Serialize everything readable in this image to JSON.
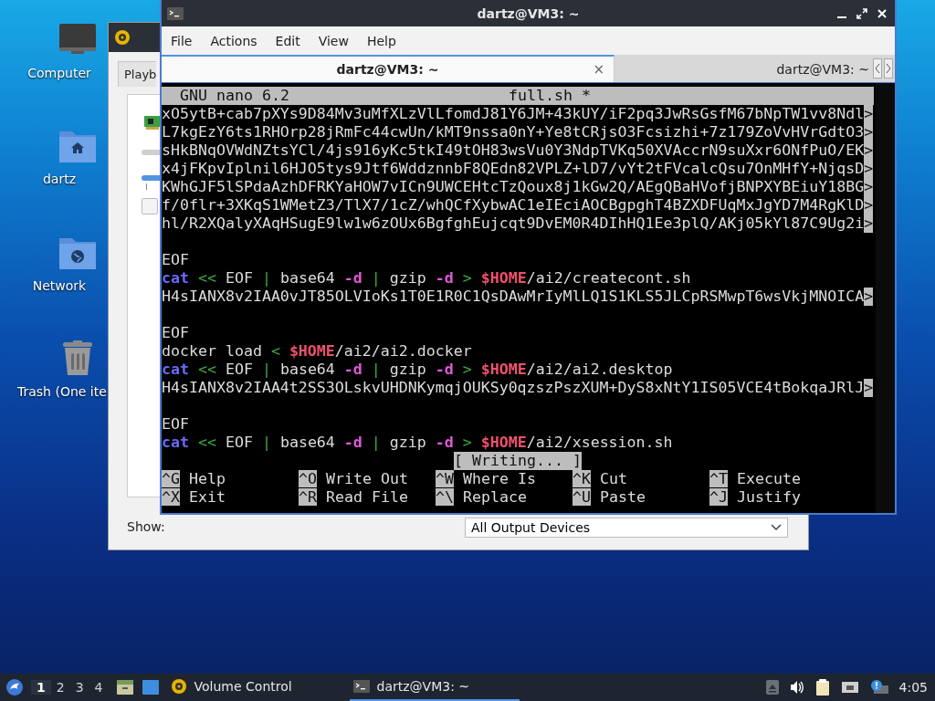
{
  "desktop_icons": [
    {
      "label": "Computer",
      "kind": "computer"
    },
    {
      "label": "dartz",
      "kind": "home"
    },
    {
      "label": "Network",
      "kind": "network"
    },
    {
      "label": "Trash (One ite",
      "kind": "trash"
    }
  ],
  "volume_window": {
    "tabs": [
      {
        "label": "Playb",
        "selected": true
      }
    ],
    "checkbox": {
      "checked": false
    },
    "show_label": "Show:",
    "device_select": "All Output Devices"
  },
  "terminal": {
    "title": "dartz@VM3: ~",
    "menu": [
      "File",
      "Actions",
      "Edit",
      "View",
      "Help"
    ],
    "tabs": [
      {
        "label": "dartz@VM3: ~",
        "selected": true,
        "close": "×"
      },
      {
        "label": "dartz@VM3: ~",
        "selected": false
      }
    ],
    "nano": {
      "version": "GNU nano 6.2",
      "filename": "full.sh *",
      "lines": [
        {
          "kind": "text",
          "segments": [
            {
              "text": "xO5ytB+cab7pXYs9D84Mv3uMfXLzVlLfomdJ81Y6JM+43kUY/iF2pq3JwRsGsfM67bNpTW1vv8Ndl",
              "kind": "plain"
            },
            {
              "text": ">",
              "kind": "more"
            }
          ]
        },
        {
          "kind": "text",
          "segments": [
            {
              "text": "L7kgEzY6ts1RHOrp28jRmFc44cwUn/kMT9nssa0nY+Ye8tCRjsO3Fcsizhi+7z179ZoVvHVrGdtO3",
              "kind": "plain"
            },
            {
              "text": ">",
              "kind": "more"
            }
          ]
        },
        {
          "kind": "text",
          "segments": [
            {
              "text": "sHkBNqOVWdNZtsYCl/4js916yKc5tkI49tOH83wsVu0Y3NdpTVKq50XVAccrN9suXxr6ONfPuO/EK",
              "kind": "plain"
            },
            {
              "text": ">",
              "kind": "more"
            }
          ]
        },
        {
          "kind": "text",
          "segments": [
            {
              "text": "x4jFKpvIplnil6HJO5tys9Jtf6WddznnbF8QEdn82VPLZ+lD7/vYt2tFVcalcQsu7OnMHfY+NjqsD",
              "kind": "plain"
            },
            {
              "text": ">",
              "kind": "more"
            }
          ]
        },
        {
          "kind": "text",
          "segments": [
            {
              "text": "KWhGJF5lSPdaAzhDFRKYaHOW7vICn9UWCEHtcTzQoux8j1kGw2Q/AEgQBaHVofjBNPXYBEiuY18BG",
              "kind": "plain"
            },
            {
              "text": ">",
              "kind": "more"
            }
          ]
        },
        {
          "kind": "text",
          "segments": [
            {
              "text": "f/0flr+3XKqS1WMetZ3/TlX7/1cZ/whQCfXybwAC1eIEciAOCBgpghT4BZXDFUqMxJgYD7M4RgKlD",
              "kind": "plain"
            },
            {
              "text": ">",
              "kind": "more"
            }
          ]
        },
        {
          "kind": "text",
          "segments": [
            {
              "text": "hl/R2XQalyXAqHSugE9lw1w6zOUx6BgfghEujcqt9DvEM0R4DIhHQ1Ee3plQ/AKj05kYl87C9Ug2i",
              "kind": "plain"
            },
            {
              "text": ">",
              "kind": "more"
            }
          ]
        },
        {
          "kind": "blank"
        },
        {
          "kind": "text",
          "segments": [
            {
              "text": "EOF",
              "kind": "plain"
            }
          ]
        },
        {
          "kind": "text",
          "segments": [
            {
              "text": "cat",
              "kind": "keyword"
            },
            {
              "text": " <<",
              "kind": "operator"
            },
            {
              "text": " EOF",
              "kind": "plain"
            },
            {
              "text": " |",
              "kind": "operator"
            },
            {
              "text": " base64",
              "kind": "plain"
            },
            {
              "text": " -d",
              "kind": "flag"
            },
            {
              "text": " |",
              "kind": "operator"
            },
            {
              "text": " gzip",
              "kind": "plain"
            },
            {
              "text": " -d",
              "kind": "flag"
            },
            {
              "text": " >",
              "kind": "operator"
            },
            {
              "text": " $HOME",
              "kind": "variable"
            },
            {
              "text": "/ai2/createcont.sh",
              "kind": "plain"
            }
          ]
        },
        {
          "kind": "text",
          "segments": [
            {
              "text": "H4sIANX8v2IAA0vJT85OLVIoKs1T0E1R0C1QsDAwMrIyMlLQ1S1KLS5JLCpRSMwpT6wsVkjMNOICA",
              "kind": "plain"
            },
            {
              "text": ">",
              "kind": "more"
            }
          ]
        },
        {
          "kind": "blank"
        },
        {
          "kind": "text",
          "segments": [
            {
              "text": "EOF",
              "kind": "plain"
            }
          ]
        },
        {
          "kind": "text",
          "segments": [
            {
              "text": "docker load",
              "kind": "plain"
            },
            {
              "text": " <",
              "kind": "operator"
            },
            {
              "text": " $HOME",
              "kind": "variable"
            },
            {
              "text": "/ai2/ai2.docker",
              "kind": "plain"
            }
          ]
        },
        {
          "kind": "text",
          "segments": [
            {
              "text": "cat",
              "kind": "keyword"
            },
            {
              "text": " <<",
              "kind": "operator"
            },
            {
              "text": " EOF",
              "kind": "plain"
            },
            {
              "text": " |",
              "kind": "operator"
            },
            {
              "text": " base64",
              "kind": "plain"
            },
            {
              "text": " -d",
              "kind": "flag"
            },
            {
              "text": " |",
              "kind": "operator"
            },
            {
              "text": " gzip",
              "kind": "plain"
            },
            {
              "text": " -d",
              "kind": "flag"
            },
            {
              "text": " >",
              "kind": "operator"
            },
            {
              "text": " $HOME",
              "kind": "variable"
            },
            {
              "text": "/ai2/ai2.desktop",
              "kind": "plain"
            }
          ]
        },
        {
          "kind": "text",
          "segments": [
            {
              "text": "H4sIANX8v2IAA4t2SS3OLskvUHDNKymqjOUKSy0qzszPszXUM+DyS8xNtY1IS05VCE4tBokqaJRlJ",
              "kind": "plain"
            },
            {
              "text": ">",
              "kind": "more"
            }
          ]
        },
        {
          "kind": "blank"
        },
        {
          "kind": "text",
          "segments": [
            {
              "text": "EOF",
              "kind": "plain"
            }
          ]
        },
        {
          "kind": "text",
          "segments": [
            {
              "text": "cat",
              "kind": "keyword"
            },
            {
              "text": " <<",
              "kind": "operator"
            },
            {
              "text": " EOF",
              "kind": "plain"
            },
            {
              "text": " |",
              "kind": "operator"
            },
            {
              "text": " base64",
              "kind": "plain"
            },
            {
              "text": " -d",
              "kind": "flag"
            },
            {
              "text": " |",
              "kind": "operator"
            },
            {
              "text": " gzip",
              "kind": "plain"
            },
            {
              "text": " -d",
              "kind": "flag"
            },
            {
              "text": " >",
              "kind": "operator"
            },
            {
              "text": " $HOME",
              "kind": "variable"
            },
            {
              "text": "/ai2/xsession.sh",
              "kind": "plain"
            }
          ]
        }
      ],
      "status": "[ Writing... ]",
      "shortcuts": [
        [
          {
            "key": "^G",
            "label": "Help"
          },
          {
            "key": "^O",
            "label": "Write Out"
          },
          {
            "key": "^W",
            "label": "Where Is"
          },
          {
            "key": "^K",
            "label": "Cut"
          },
          {
            "key": "^T",
            "label": "Execute"
          }
        ],
        [
          {
            "key": "^X",
            "label": "Exit"
          },
          {
            "key": "^R",
            "label": "Read File"
          },
          {
            "key": "^\\",
            "label": "Replace"
          },
          {
            "key": "^U",
            "label": "Paste"
          },
          {
            "key": "^J",
            "label": "Justify"
          }
        ]
      ]
    }
  },
  "taskbar": {
    "workspaces": [
      {
        "label": "1",
        "selected": true
      },
      {
        "label": "2",
        "selected": false
      },
      {
        "label": "3",
        "selected": false
      },
      {
        "label": "4",
        "selected": false
      }
    ],
    "tasks": [
      {
        "label": "Volume Control",
        "kind": "volume",
        "selected": false
      },
      {
        "label": "dartz@VM3: ~",
        "kind": "terminal",
        "selected": true
      }
    ],
    "clock": "4:05"
  }
}
